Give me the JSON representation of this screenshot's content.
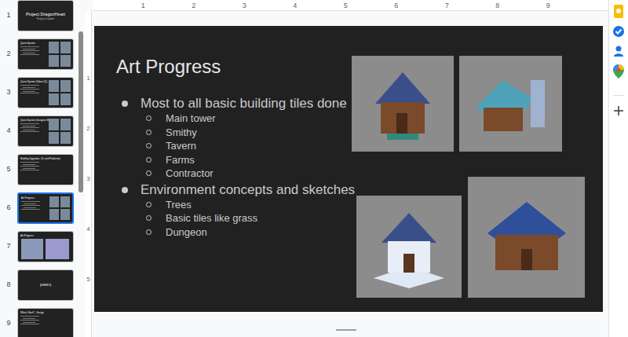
{
  "ruler": {
    "marks": [
      "1",
      "2",
      "3",
      "4",
      "5",
      "6",
      "7",
      "8",
      "9"
    ]
  },
  "vruler": {
    "marks": [
      "1",
      "2",
      "3",
      "4",
      "5"
    ]
  },
  "slides": [
    {
      "number": "1",
      "kind": "title",
      "title": "Project DragonHeart",
      "subtitle": "Progress Update",
      "selected": false
    },
    {
      "number": "2",
      "kind": "content",
      "title": "Quest System",
      "selected": false
    },
    {
      "number": "3",
      "kind": "content",
      "title": "Quest System (Taken (1))",
      "selected": false
    },
    {
      "number": "4",
      "kind": "content",
      "title": "Quest System (Dungeon Battles)",
      "selected": false
    },
    {
      "number": "5",
      "kind": "text",
      "title": "Building Upgrades, UI, and Production",
      "selected": false
    },
    {
      "number": "6",
      "kind": "content",
      "title": "Art Progress",
      "selected": true
    },
    {
      "number": "7",
      "kind": "images",
      "title": "Art Progress",
      "selected": false
    },
    {
      "number": "8",
      "kind": "center",
      "title": "[DEMO]",
      "selected": false
    },
    {
      "number": "9",
      "kind": "text",
      "title": "What's Next? - Design",
      "selected": false
    }
  ],
  "slide": {
    "title": "Art Progress",
    "bullets": [
      {
        "text": "Most to all basic building tiles done",
        "kind": "main"
      },
      {
        "text": "Main tower",
        "kind": "sub"
      },
      {
        "text": "Smithy",
        "kind": "sub"
      },
      {
        "text": "Tavern",
        "kind": "sub"
      },
      {
        "text": "Farms",
        "kind": "sub"
      },
      {
        "text": "Contractor",
        "kind": "sub"
      },
      {
        "text": "Environment concepts and sketches",
        "kind": "main"
      },
      {
        "text": "Trees",
        "kind": "sub"
      },
      {
        "text": "Basic tiles like grass",
        "kind": "sub"
      },
      {
        "text": "Dungeon",
        "kind": "sub"
      }
    ]
  }
}
